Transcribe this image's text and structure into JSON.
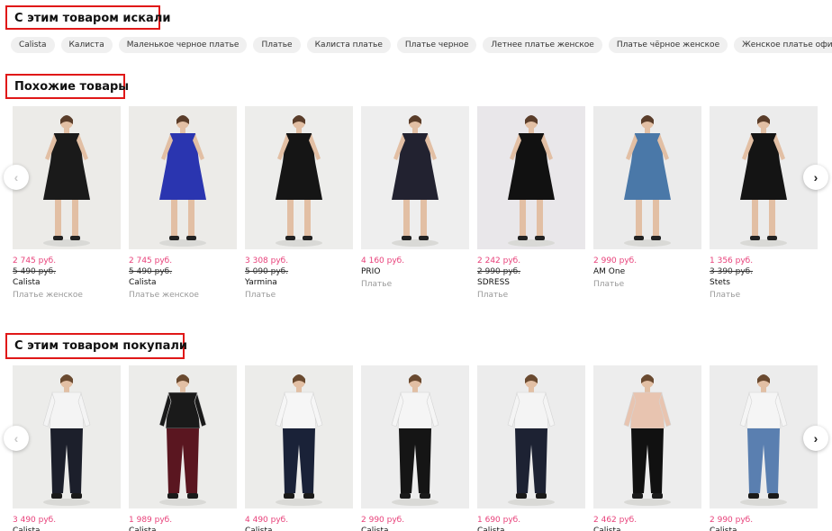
{
  "sections": {
    "searched_title": "С этим товаром искали",
    "similar_title": "Похожие товары",
    "bought_title": "С этим товаром покупали"
  },
  "tags": [
    "Calista",
    "Калиста",
    "Маленькое черное платье",
    "Платье",
    "Калиста платье",
    "Платье черное",
    "Летнее платье женское",
    "Платье чёрное женское",
    "Женское платье офисное"
  ],
  "similar": [
    {
      "price": "2 745 руб.",
      "old_price": "5 490 руб.",
      "brand": "Calista",
      "category": "Платье женское",
      "dress_color": "#1a1a1a",
      "bg": "#ecebe8"
    },
    {
      "price": "2 745 руб.",
      "old_price": "5 490 руб.",
      "brand": "Calista",
      "category": "Платье женское",
      "dress_color": "#2a35b0",
      "bg": "#ecebe8"
    },
    {
      "price": "3 308 руб.",
      "old_price": "5 090 руб.",
      "brand": "Yarmina",
      "category": "Платье",
      "dress_color": "#151515",
      "bg": "#ededeb"
    },
    {
      "price": "4 160 руб.",
      "old_price": "",
      "brand": "PRIO",
      "category": "Платье",
      "dress_color": "#222230",
      "bg": "#eeeeee"
    },
    {
      "price": "2 242 руб.",
      "old_price": "2 990 руб.",
      "brand": "SDRESS",
      "category": "Платье",
      "dress_color": "#111111",
      "bg": "#e9e7ea"
    },
    {
      "price": "2 990 руб.",
      "old_price": "",
      "brand": "AM One",
      "category": "Платье",
      "dress_color": "#4a78a8",
      "bg": "#ebebeb"
    },
    {
      "price": "1 356 руб.",
      "old_price": "3 390 руб.",
      "brand": "Stets",
      "category": "Платье",
      "dress_color": "#141414",
      "bg": "#ececec"
    }
  ],
  "bought": [
    {
      "price": "3 490 руб.",
      "brand": "Calista",
      "top_color": "#f4f4f4",
      "bottom_color": "#1c1f2b",
      "bg": "#ececea"
    },
    {
      "price": "1 989 руб.",
      "brand": "Calista",
      "top_color": "#1a1a1a",
      "bottom_color": "#5a1620",
      "bg": "#ececea"
    },
    {
      "price": "4 490 руб.",
      "brand": "Calista",
      "top_color": "#f6f6f6",
      "bottom_color": "#1a2238",
      "bg": "#ececea"
    },
    {
      "price": "2 990 руб.",
      "brand": "Calista",
      "top_color": "#f5f5f5",
      "bottom_color": "#151515",
      "bg": "#ededed"
    },
    {
      "price": "1 690 руб.",
      "brand": "Calista",
      "top_color": "#f4f4f4",
      "bottom_color": "#1d2233",
      "bg": "#ececec"
    },
    {
      "price": "2 462 руб.",
      "brand": "Calista",
      "top_color": "#e8c4b0",
      "bottom_color": "#111111",
      "bg": "#ededed"
    },
    {
      "price": "2 990 руб.",
      "brand": "Calista",
      "top_color": "#f5f5f5",
      "bottom_color": "#5a7fb0",
      "bg": "#ececec"
    }
  ],
  "arrows": {
    "left": "‹",
    "right": "›"
  }
}
